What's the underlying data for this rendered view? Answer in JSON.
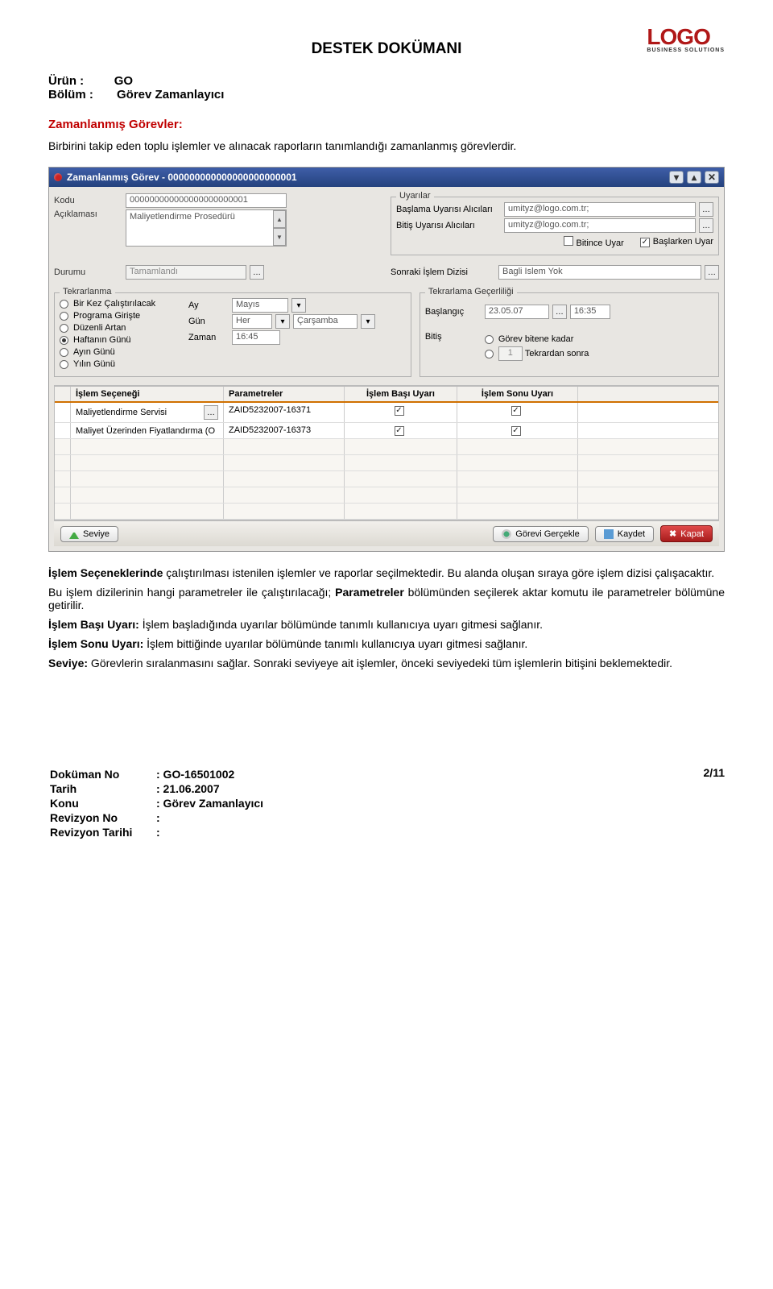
{
  "doc": {
    "title": "DESTEK DOKÜMANI",
    "urun_label": "Ürün   :",
    "urun_value": "GO",
    "bolum_label": "Bölüm :",
    "bolum_value": "Görev Zamanlayıcı",
    "section_heading": "Zamanlanmış Görevler:",
    "intro": "Birbirini takip eden toplu işlemler ve alınacak raporların tanımlandığı zamanlanmış görevlerdir."
  },
  "logo": {
    "main": "LOGO",
    "sub": "BUSINESS SOLUTIONS"
  },
  "dialog": {
    "title": "Zamanlanmış Görev - 000000000000000000000001",
    "kodu_lbl": "Kodu",
    "kodu_val": "000000000000000000000001",
    "aciklama_lbl": "Açıklaması",
    "aciklama_val": "Maliyetlendirme Prosedürü",
    "uyarilar_legend": "Uyarılar",
    "baslama_lbl": "Başlama Uyarısı Alıcıları",
    "baslama_val": "umityz@logo.com.tr;",
    "bitis_lbl": "Bitiş Uyarısı Alıcıları",
    "bitis_val": "umityz@logo.com.tr;",
    "bitince_chk": "Bitince Uyar",
    "baslarken_chk": "Başlarken Uyar",
    "durumu_lbl": "Durumu",
    "durumu_val": "Tamamlandı",
    "sonraki_lbl": "Sonraki İşlem Dizisi",
    "sonraki_val": "Bagli Islem Yok",
    "tekrarlanma_legend": "Tekrarlanma",
    "radios": {
      "r1": "Bir Kez Çalıştırılacak",
      "r2": "Programa Girişte",
      "r3": "Düzenli Artan",
      "r4": "Haftanın Günü",
      "r5": "Ayın Günü",
      "r6": "Yılın Günü"
    },
    "ay_lbl": "Ay",
    "ay_val": "Mayıs",
    "gun_lbl": "Gün",
    "gun_val": "Her",
    "gun2_val": "Çarşamba",
    "zaman_lbl": "Zaman",
    "zaman_val": "16:45",
    "gecerlilik_legend": "Tekrarlama Geçerliliği",
    "baslangic_lbl": "Başlangıç",
    "baslangic_date": "23.05.07",
    "baslangic_time": "16:35",
    "bitis2_lbl": "Bitiş",
    "bitis_opt1": "Görev bitene kadar",
    "bitis_opt2_val": "1",
    "bitis_opt2_lbl": "Tekrardan sonra",
    "col1": "İşlem Seçeneği",
    "col2": "Parametreler",
    "col3": "İşlem Başı Uyarı",
    "col4": "İşlem Sonu Uyarı",
    "rows": [
      {
        "name": "Maliyetlendirme Servisi",
        "param": "ZAID5232007-16371",
        "c3": true,
        "c4": true
      },
      {
        "name": "Maliyet Üzerinden Fiyatlandırma (O",
        "param": "ZAID5232007-16373",
        "c3": true,
        "c4": true
      }
    ],
    "seviye_btn": "Seviye",
    "gerc_btn": "Görevi Gerçekle",
    "kaydet_btn": "Kaydet",
    "kapat_btn": "Kapat"
  },
  "paras": {
    "p1a": "İşlem Seçeneklerinde",
    "p1b": "  çalıştırılması istenilen işlemler ve raporlar seçilmektedir. Bu alanda oluşan sıraya göre işlem dizisi çalışacaktır.",
    "p2a": "Bu işlem dizilerinin hangi parametreler ile çalıştırılacağı; ",
    "p2b": "Parametreler",
    "p2c": " bölümünden seçilerek aktar komutu ile parametreler bölümüne getirilir.",
    "p3a": "İşlem Başı Uyarı:",
    "p3b": " İşlem başladığında uyarılar bölümünde tanımlı kullanıcıya uyarı gitmesi sağlanır.",
    "p4a": "İşlem Sonu Uyarı:",
    "p4b": " İşlem bittiğinde uyarılar bölümünde tanımlı kullanıcıya uyarı gitmesi sağlanır.",
    "p5a": "Seviye:",
    "p5b": " Görevlerin sıralanmasını sağlar. Sonraki seviyeye ait işlemler, önceki seviyedeki tüm işlemlerin bitişini beklemektedir."
  },
  "footer": {
    "dokno_l": "Doküman No",
    "dokno_v": ": GO-16501002",
    "tarih_l": "Tarih",
    "tarih_v": ": 21.06.2007",
    "konu_l": "Konu",
    "konu_v": ": Görev Zamanlayıcı",
    "revno_l": "Revizyon No",
    "revno_v": ":",
    "revt_l": "Revizyon Tarihi",
    "revt_v": ":",
    "page": "2/11"
  }
}
